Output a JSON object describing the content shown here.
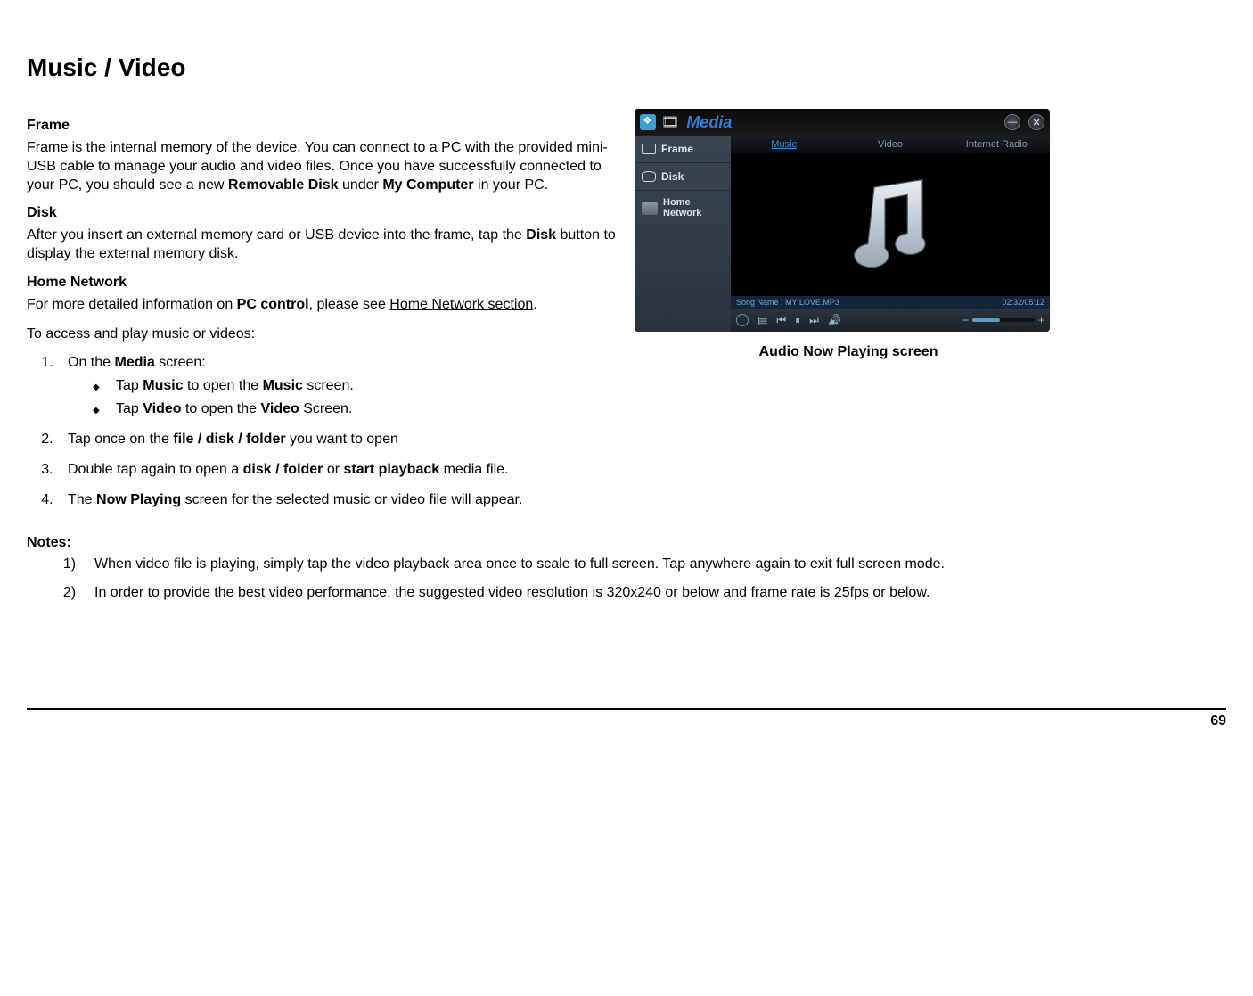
{
  "page": {
    "title": "Music / Video",
    "number": "69"
  },
  "sections": {
    "frame": {
      "heading": "Frame",
      "text_pre": "Frame is the internal memory of the device.  You can connect to a PC with the provided mini-USB cable to manage your audio and video files.  Once you have successfully connected to your PC, you should see a new ",
      "bold1": "Removable Disk",
      "mid": " under ",
      "bold2": "My Computer",
      "post": " in your PC."
    },
    "disk": {
      "heading": "Disk",
      "text_pre": "After you insert an external memory card or USB device into the frame, tap the ",
      "bold1": "Disk",
      "post": " button to display the external memory disk."
    },
    "homenet": {
      "heading": "Home Network",
      "text_pre": "For more detailed information on ",
      "bold1": "PC control",
      "mid": ", please see ",
      "link": "Home Network section",
      "post": "."
    },
    "access_intro": "To access and play music or videos:",
    "step1": {
      "pre": "On the ",
      "b": "Media",
      "post": " screen:",
      "sub1": {
        "pre": "Tap ",
        "b1": "Music",
        "mid": " to open the ",
        "b2": "Music",
        "post": " screen."
      },
      "sub2": {
        "pre": "Tap ",
        "b1": "Video",
        "mid": " to open the ",
        "b2": "Video",
        "post": " Screen."
      }
    },
    "step2": {
      "pre": "Tap once on the ",
      "b": "file / disk / folder",
      "post": " you want to open"
    },
    "step3": {
      "pre": "Double tap again to open a ",
      "b1": "disk / folder",
      "mid": " or ",
      "b2": "start playback",
      "post": " media file."
    },
    "step4": {
      "pre": "The ",
      "b": "Now Playing",
      "post": " screen for the selected music or video file will appear."
    },
    "notes_h": "Notes:",
    "note1": "When video file is playing, simply tap the video playback area once to scale to full screen.  Tap anywhere again to exit full screen mode.",
    "note2": "In order to provide the best video performance, the suggested video resolution is 320x240 or below and frame rate is 25fps or below."
  },
  "figure": {
    "caption": "Audio Now Playing screen",
    "titlebar": "Media",
    "tabs": {
      "music": "Music",
      "video": "Video",
      "radio": "Internet Radio"
    },
    "sidebar": {
      "frame": "Frame",
      "disk": "Disk",
      "home1": "Home",
      "home2": "Network"
    },
    "status_left": "Song Name : MY LOVE.MP3",
    "status_right": "02:32/05:12",
    "minus": "−",
    "plus": "+"
  }
}
